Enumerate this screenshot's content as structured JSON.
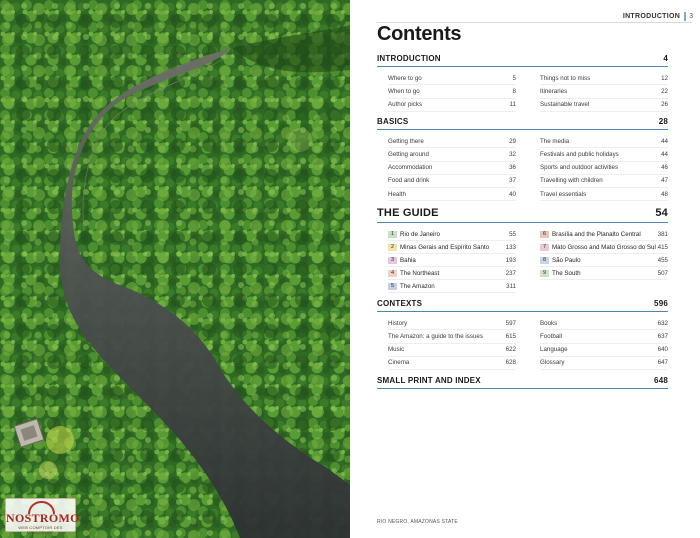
{
  "header": {
    "section": "INTRODUCTION",
    "page_number": "3"
  },
  "title": "Contents",
  "sections": {
    "introduction": {
      "title": "INTRODUCTION",
      "page": "4",
      "left": [
        {
          "label": "Where to go",
          "page": "5"
        },
        {
          "label": "When to go",
          "page": "8"
        },
        {
          "label": "Author picks",
          "page": "11"
        }
      ],
      "right": [
        {
          "label": "Things not to miss",
          "page": "12"
        },
        {
          "label": "Itineraries",
          "page": "22"
        },
        {
          "label": "Sustainable travel",
          "page": "26"
        }
      ]
    },
    "basics": {
      "title": "BASICS",
      "page": "28",
      "left": [
        {
          "label": "Getting there",
          "page": "29"
        },
        {
          "label": "Getting around",
          "page": "32"
        },
        {
          "label": "Accommodation",
          "page": "36"
        },
        {
          "label": "Food and drink",
          "page": "37"
        },
        {
          "label": "Health",
          "page": "40"
        }
      ],
      "right": [
        {
          "label": "The media",
          "page": "44"
        },
        {
          "label": "Festivals and public holidays",
          "page": "44"
        },
        {
          "label": "Sports and outdoor activities",
          "page": "46"
        },
        {
          "label": "Travelling with children",
          "page": "47"
        },
        {
          "label": "Travel essentials",
          "page": "48"
        }
      ]
    },
    "guide": {
      "title": "THE GUIDE",
      "page": "54",
      "left": [
        {
          "num": "1",
          "label": "Rio de Janeiro",
          "page": "55",
          "color": "#c9e0c4"
        },
        {
          "num": "2",
          "label": "Minas Gerais and Espírito Santo",
          "page": "133",
          "color": "#f3e3a8"
        },
        {
          "num": "3",
          "label": "Bahia",
          "page": "193",
          "color": "#e3c8e0"
        },
        {
          "num": "4",
          "label": "The Northeast",
          "page": "237",
          "color": "#f3cfc4"
        },
        {
          "num": "5",
          "label": "The Amazon",
          "page": "311",
          "color": "#c6cde6"
        }
      ],
      "right": [
        {
          "num": "6",
          "label": "Brasília and the Planalto Central",
          "page": "381",
          "color": "#e8c6b8"
        },
        {
          "num": "7",
          "label": "Mato Grosso and Mato Grosso do Sul",
          "page": "415",
          "color": "#efc7d0"
        },
        {
          "num": "8",
          "label": "São Paulo",
          "page": "455",
          "color": "#c4d6ea"
        },
        {
          "num": "9",
          "label": "The South",
          "page": "507",
          "color": "#cfe3c8"
        }
      ]
    },
    "contexts": {
      "title": "CONTEXTS",
      "page": "596",
      "left": [
        {
          "label": "History",
          "page": "597"
        },
        {
          "label": "The Amazon: a guide to the issues",
          "page": "615"
        },
        {
          "label": "Music",
          "page": "622"
        },
        {
          "label": "Cinema",
          "page": "628"
        }
      ],
      "right": [
        {
          "label": "Books",
          "page": "632"
        },
        {
          "label": "Football",
          "page": "637"
        },
        {
          "label": "Language",
          "page": "640"
        },
        {
          "label": "Glossary",
          "page": "647"
        }
      ]
    },
    "small_print": {
      "title": "SMALL PRINT AND INDEX",
      "page": "648"
    }
  },
  "caption": "RIO NEGRO, AMAZONAS STATE",
  "logo": {
    "word": "NOSTROMO",
    "tagline": "WEB COMPTOIR DES VOYAGEURS"
  },
  "colors": {
    "accent_rule": "#4e86b0",
    "header_bar": "#7fa9c9",
    "river": "#4a4e50",
    "forest": "#2f6b25"
  }
}
